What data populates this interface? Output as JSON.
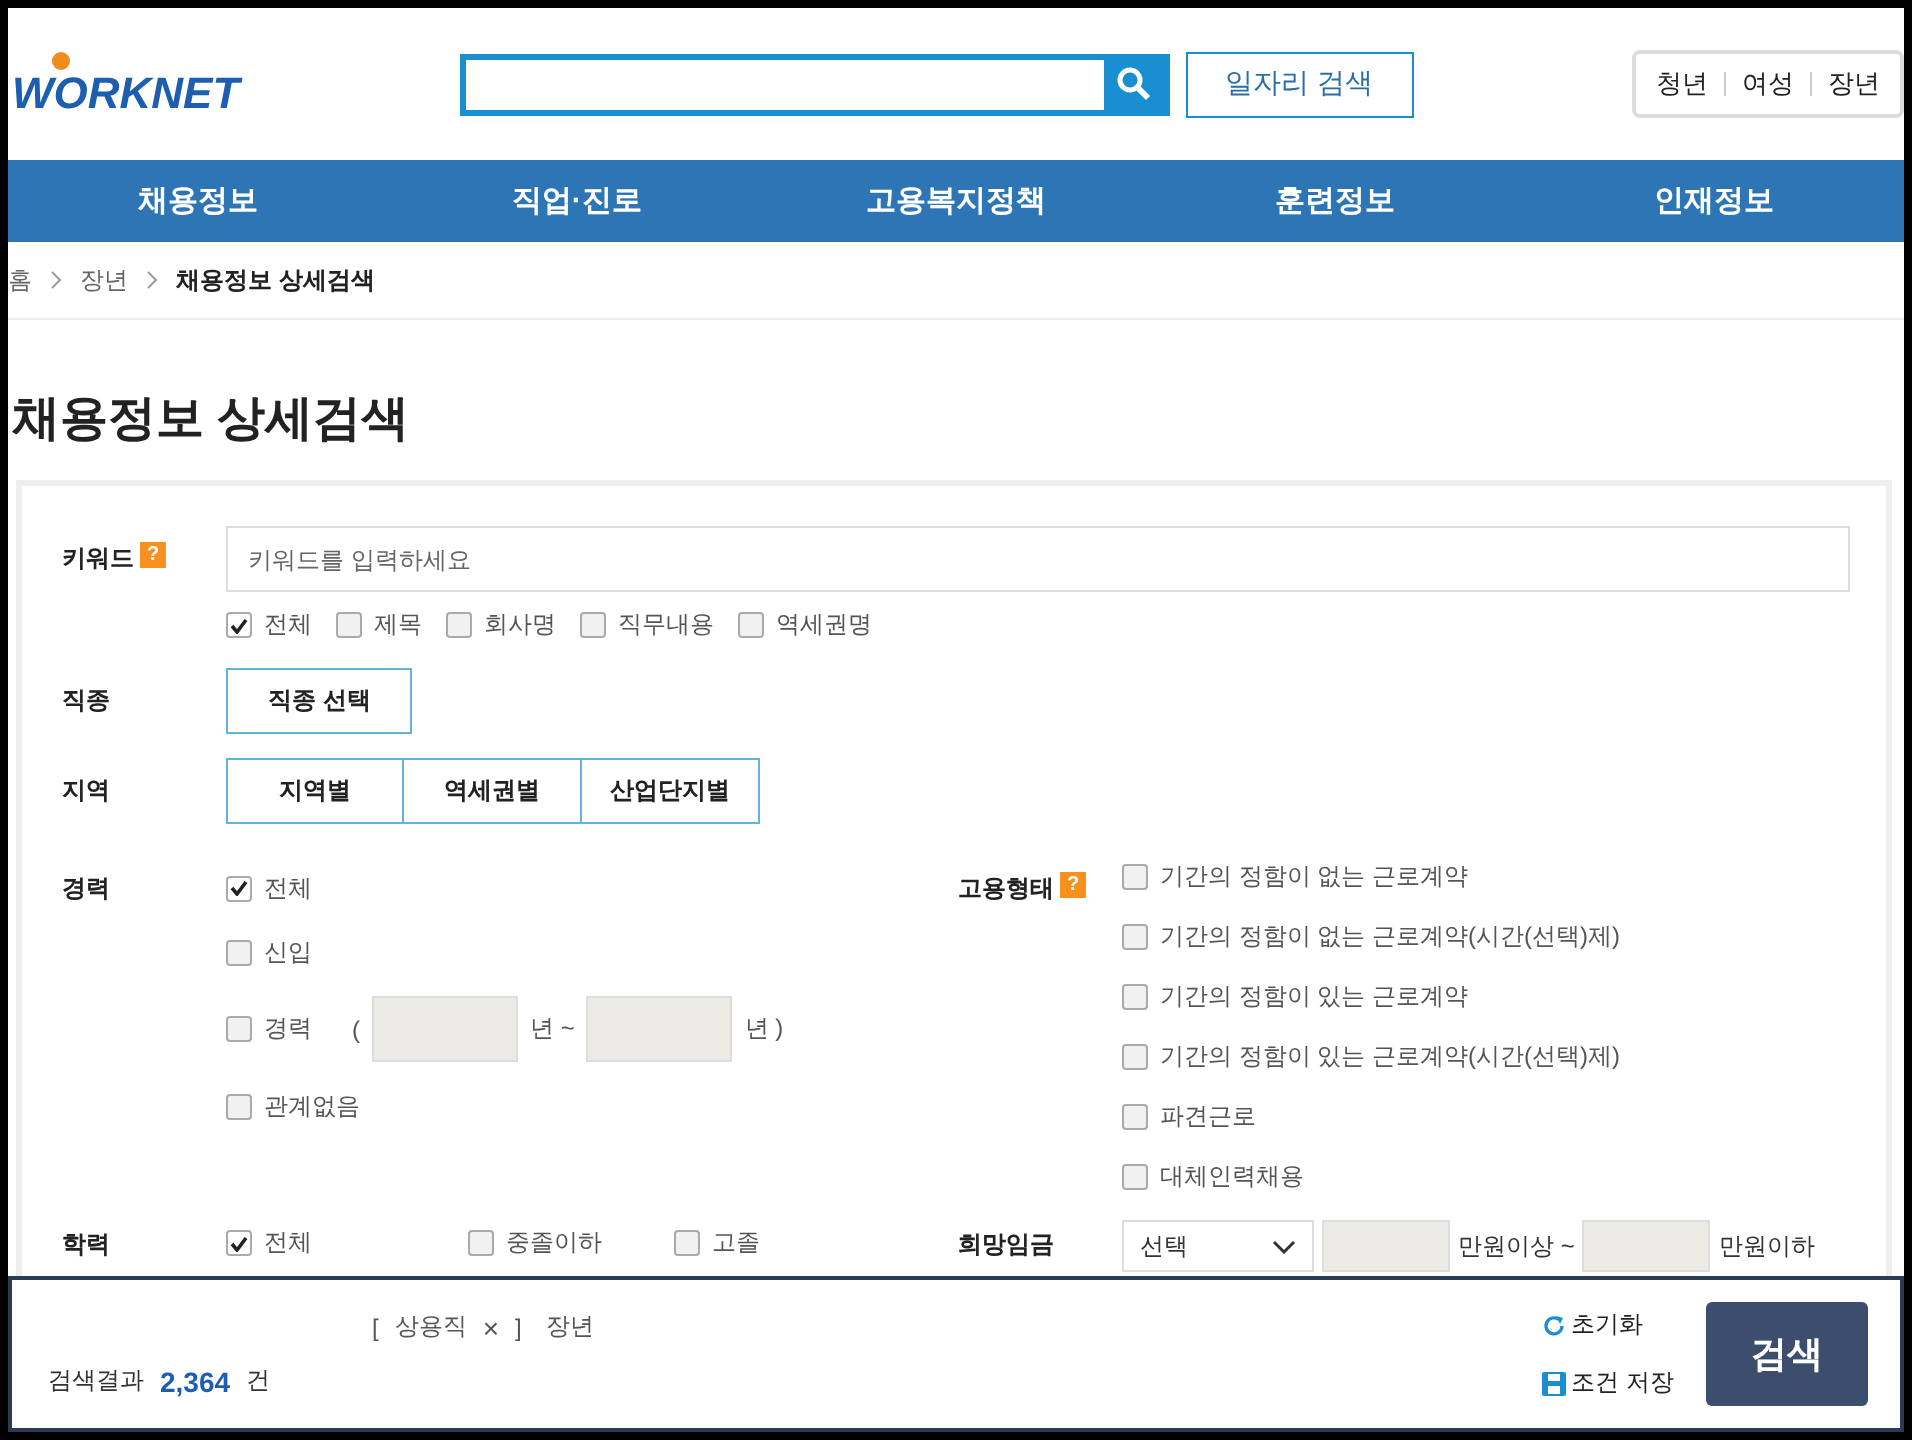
{
  "logo": {
    "text": "WORKNET"
  },
  "search": {
    "button": "일자리 검색"
  },
  "audience_links": [
    "청년",
    "여성",
    "장년"
  ],
  "nav": [
    "채용정보",
    "직업·진로",
    "고용복지정책",
    "훈련정보",
    "인재정보"
  ],
  "breadcrumb": [
    "홈",
    "장년",
    "채용정보 상세검색"
  ],
  "page_title": "채용정보 상세검색",
  "keyword": {
    "label": "키워드",
    "help": "?",
    "placeholder": "키워드를 입력하세요",
    "options": [
      {
        "label": "전체",
        "checked": true
      },
      {
        "label": "제목",
        "checked": false
      },
      {
        "label": "회사명",
        "checked": false
      },
      {
        "label": "직무내용",
        "checked": false
      },
      {
        "label": "역세권명",
        "checked": false
      }
    ]
  },
  "job_type": {
    "label": "직종",
    "button": "직종 선택"
  },
  "region": {
    "label": "지역",
    "buttons": [
      "지역별",
      "역세권별",
      "산업단지별"
    ]
  },
  "career": {
    "label": "경력",
    "options": [
      {
        "kind": "checkbox",
        "label": "전체",
        "checked": true
      },
      {
        "kind": "checkbox",
        "label": "신입",
        "checked": false
      },
      {
        "kind": "range",
        "label": "경력",
        "checked": false,
        "open": "(",
        "middle": "년 ~",
        "close": "년 )"
      },
      {
        "kind": "checkbox",
        "label": "관계없음",
        "checked": false
      }
    ]
  },
  "employment": {
    "label": "고용형태",
    "help": "?",
    "options": [
      {
        "label": "기간의 정함이 없는 근로계약",
        "checked": false
      },
      {
        "label": "기간의 정함이 없는 근로계약(시간(선택)제)",
        "checked": false
      },
      {
        "label": "기간의 정함이 있는 근로계약",
        "checked": false
      },
      {
        "label": "기간의 정함이 있는 근로계약(시간(선택)제)",
        "checked": false
      },
      {
        "label": "파견근로",
        "checked": false
      },
      {
        "label": "대체인력채용",
        "checked": false
      }
    ]
  },
  "education": {
    "label": "학력",
    "options": [
      {
        "label": "전체",
        "checked": true
      },
      {
        "label": "중졸이하",
        "checked": false
      },
      {
        "label": "고졸",
        "checked": false
      }
    ]
  },
  "salary": {
    "label": "희망임금",
    "select": "선택",
    "min_unit": "만원이상 ~",
    "max_unit": "만원이하"
  },
  "bottom_bar": {
    "tags": [
      {
        "open": "[",
        "label": "상용직",
        "remove": "×",
        "close": "]"
      },
      {
        "label": "장년"
      }
    ],
    "result_label": "검색결과",
    "result_count": "2,364",
    "result_unit": "건",
    "reset": "초기화",
    "save": "조건 저장",
    "search": "검색"
  }
}
